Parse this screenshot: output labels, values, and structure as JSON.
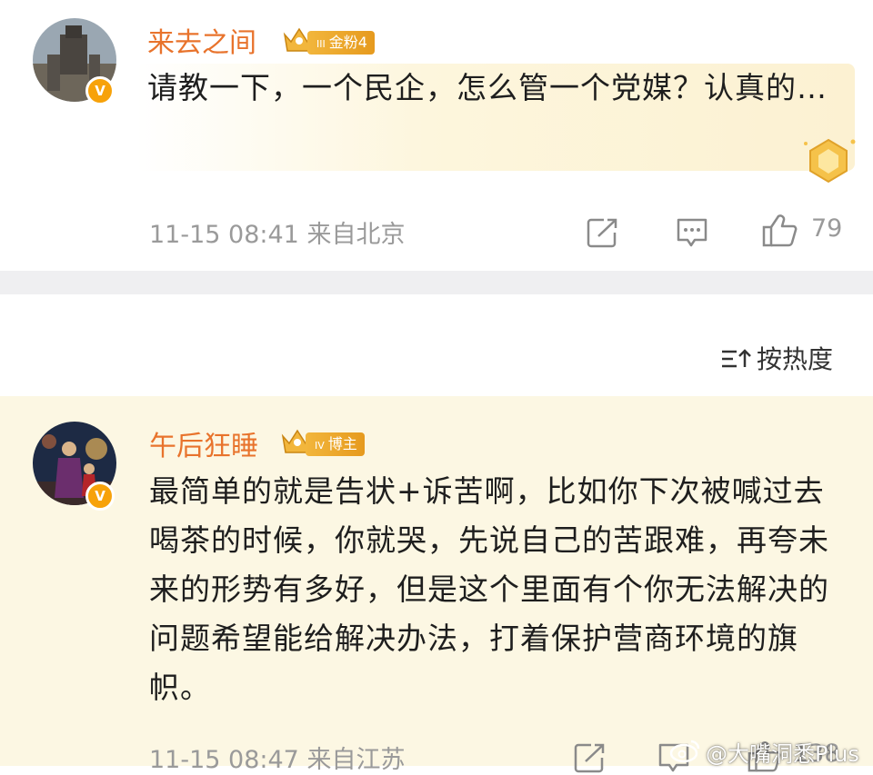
{
  "comment1": {
    "username": "来去之间",
    "badge_level": "III",
    "badge_label": "金粉4",
    "text": "请教一下，一个民企，怎么管一个党媒？认真的…",
    "time": "11-15 08:41",
    "location": "来自北京",
    "like_count": "79",
    "verified_mark": "V"
  },
  "sort": {
    "label": "按热度"
  },
  "comment2": {
    "username": "午后狂睡",
    "badge_level": "IV",
    "badge_label": "博主",
    "text": "最简单的就是告状+诉苦啊，比如你下次被喊过去喝茶的时候，你就哭，先说自己的苦跟难，再夸未来的形势有多好，但是这个里面有个你无法解决的问题希望能给解决办法，打着保护营商环境的旗帜。",
    "time": "11-15 08:47",
    "location": "来自江苏",
    "like_count": "138",
    "verified_mark": "V"
  },
  "watermark": "@大嘴洞悉Plus",
  "colors": {
    "username": "#e8732c",
    "badge_gold": "#f2b63c",
    "card2_background": "#fcf7e3",
    "divider": "#efeff1",
    "meta_gray": "#9a9a9a"
  },
  "icons": [
    "share-icon",
    "comment-icon",
    "like-icon",
    "sort-icon",
    "verified-icon",
    "crown-icon",
    "gold-coin-icon",
    "weibo-logo-icon"
  ]
}
